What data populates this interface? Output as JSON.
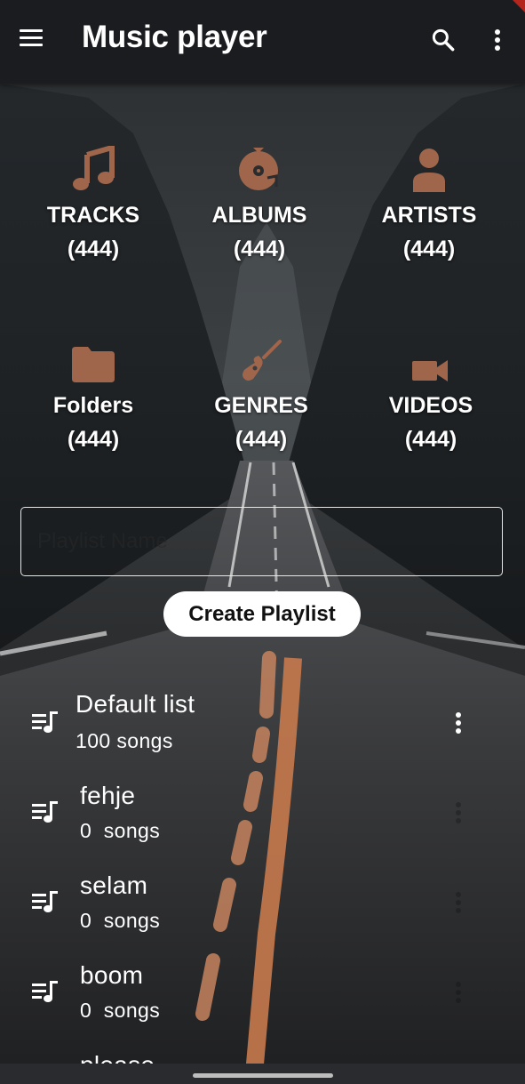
{
  "app": {
    "title": "Music player",
    "menu_icon": "menu-icon",
    "search_icon": "search-icon",
    "more_icon": "more-vert-icon"
  },
  "colors": {
    "accent": "#a0664c",
    "appbar": "#1b1c1f",
    "text": "#ffffff",
    "button_bg": "#ffffff"
  },
  "categories": [
    {
      "label": "TRACKS",
      "count": "(444)",
      "icon": "music-note-icon"
    },
    {
      "label": "ALBUMS",
      "count": "(444)",
      "icon": "album-icon"
    },
    {
      "label": "ARTISTS",
      "count": "(444)",
      "icon": "person-icon"
    },
    {
      "label": "Folders",
      "count": "(444)",
      "icon": "folder-icon"
    },
    {
      "label": "GENRES",
      "count": "(444)",
      "icon": "guitar-icon"
    },
    {
      "label": "VIDEOS",
      "count": "(444)",
      "icon": "videocam-icon"
    }
  ],
  "playlist_form": {
    "placeholder": "Playlist Name",
    "value": "",
    "create_label": "Create Playlist"
  },
  "playlists": [
    {
      "name": "Default list",
      "count": "100 songs",
      "icon": "queue-music-icon"
    },
    {
      "name": "fehje",
      "count": "0  songs",
      "icon": "queue-music-icon"
    },
    {
      "name": "selam",
      "count": "0  songs",
      "icon": "queue-music-icon"
    },
    {
      "name": "boom",
      "count": "0  songs",
      "icon": "queue-music-icon"
    },
    {
      "name": "please",
      "count": "",
      "icon": "queue-music-icon"
    }
  ]
}
